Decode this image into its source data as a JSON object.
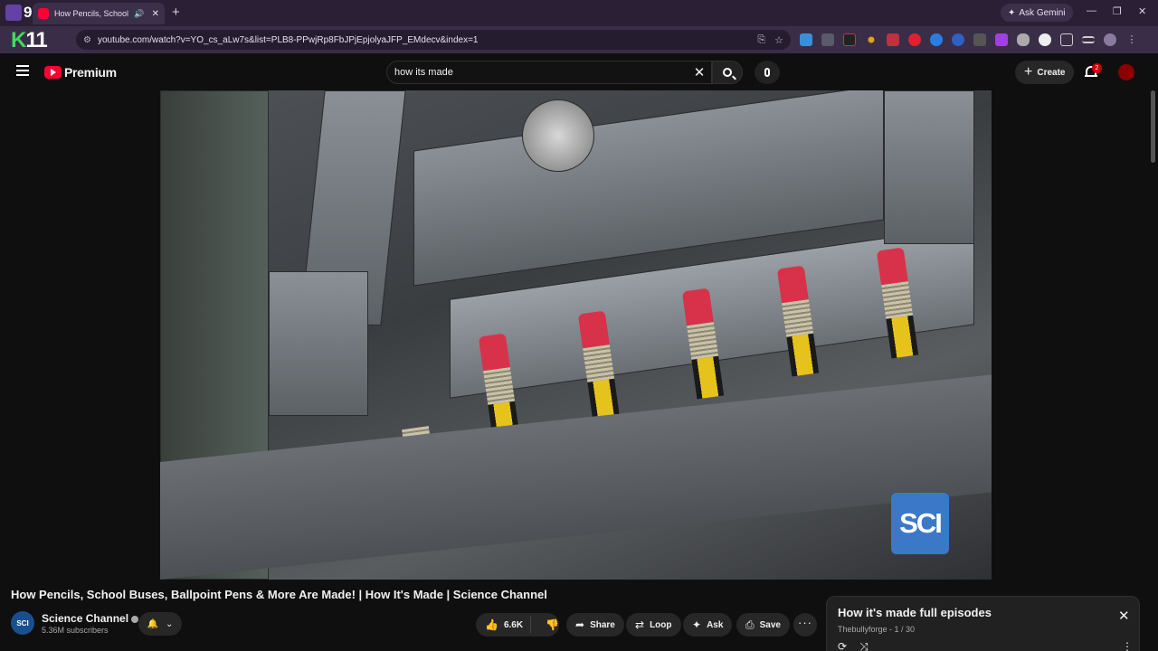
{
  "browser": {
    "tab_title": "How Pencils, School Bus",
    "new_tab": "+",
    "ask_gemini": "Ask Gemini",
    "url": "youtube.com/watch?v=YO_cs_aLw7s&list=PLB8-PPwjRp8FbJPjEpjolyaJFP_EMdecv&index=1",
    "profile_badge": "11"
  },
  "header": {
    "logo_text": "Premium",
    "search_value": "how its made",
    "create_label": "Create",
    "notification_count": "2"
  },
  "video": {
    "title": "How Pencils, School Buses, Ballpoint Pens & More Are Made! | How It's Made | Science Channel",
    "watermark": "SCI"
  },
  "channel": {
    "avatar_text": "SCI",
    "name": "Science Channel",
    "subscribers": "5.36M subscribers"
  },
  "actions": {
    "likes": "6.6K",
    "share": "Share",
    "loop": "Loop",
    "ask": "Ask",
    "save": "Save"
  },
  "playlist": {
    "title": "How it's made full episodes",
    "subtitle": "Thebullyforge - 1 / 30"
  },
  "colors": {
    "youtube_red": "#ff0033",
    "browser_frame": "#2a1f35",
    "sci_blue": "#3c78c8"
  }
}
